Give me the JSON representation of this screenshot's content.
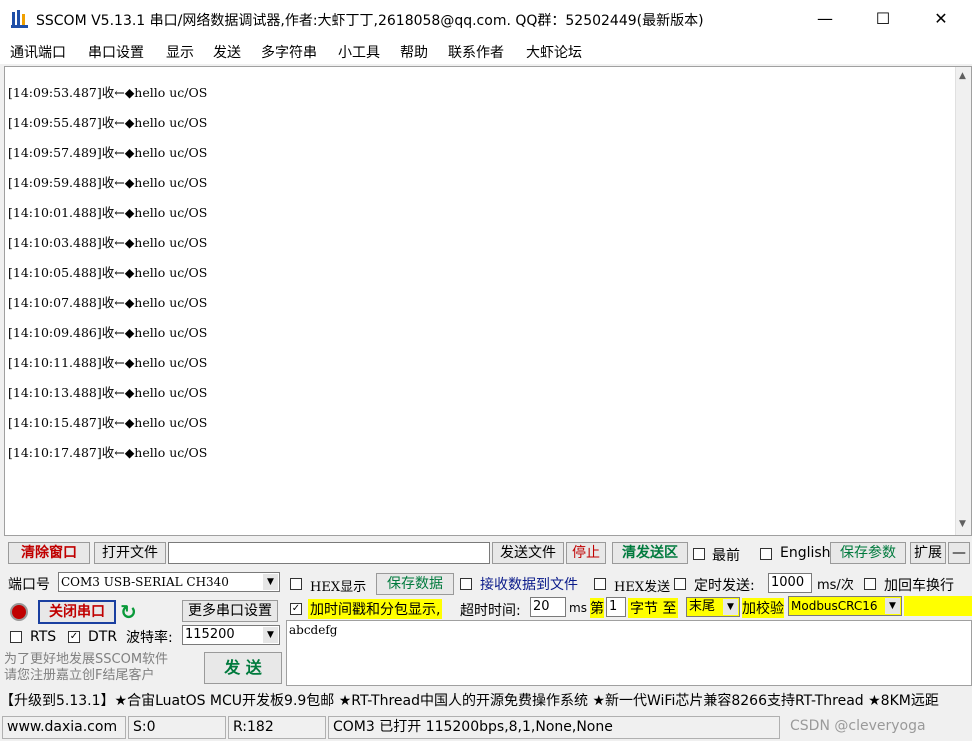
{
  "window": {
    "title": "SSCOM V5.13.1 串口/网络数据调试器,作者:大虾丁丁,2618058@qq.com. QQ群：52502449(最新版本)",
    "minimize": "—",
    "maximize": "☐",
    "close": "✕"
  },
  "menu": [
    "通讯端口",
    "串口设置",
    "显示",
    "发送",
    "多字符串",
    "小工具",
    "帮助",
    "联系作者",
    "大虾论坛"
  ],
  "log": [
    "[14:09:53.487]收←◆hello uc/OS",
    "[14:09:55.487]收←◆hello uc/OS",
    "[14:09:57.489]收←◆hello uc/OS",
    "[14:09:59.488]收←◆hello uc/OS",
    "[14:10:01.488]收←◆hello uc/OS",
    "[14:10:03.488]收←◆hello uc/OS",
    "[14:10:05.488]收←◆hello uc/OS",
    "[14:10:07.488]收←◆hello uc/OS",
    "[14:10:09.486]收←◆hello uc/OS",
    "[14:10:11.488]收←◆hello uc/OS",
    "[14:10:13.488]收←◆hello uc/OS",
    "[14:10:15.487]收←◆hello uc/OS",
    "[14:10:17.487]收←◆hello uc/OS"
  ],
  "toolbar": {
    "clear": "清除窗口",
    "open_file": "打开文件",
    "send_file": "发送文件",
    "stop": "停止",
    "clear_send": "清发送区",
    "topmost": "最前",
    "english": "English",
    "save_params": "保存参数",
    "expand": "扩展",
    "collapse": "—"
  },
  "port": {
    "label": "端口号",
    "value": "COM3 USB-SERIAL CH340",
    "close_port": "关闭串口",
    "more_settings": "更多串口设置",
    "rts": "RTS",
    "dtr": "DTR",
    "baud_label": "波特率:",
    "baud_value": "115200",
    "promo": "为了更好地发展SSCOM软件\n请您注册嘉立创F结尾客户",
    "send": "发  送"
  },
  "options": {
    "hex_display": "HEX显示",
    "save_data": "保存数据",
    "recv_to_file": "接收数据到文件",
    "hex_send": "HEX发送",
    "timed_send": "定时发送:",
    "interval": "1000",
    "interval_unit": "ms/次",
    "add_crlf": "加回车换行",
    "timestamp": "加时间戳和分包显示,",
    "timeout_label": "超时时间:",
    "timeout_value": "20",
    "timeout_unit": "ms",
    "byte_prefix": "第",
    "byte_index": "1",
    "byte_suffix": "字节 至",
    "byte_end": "末尾",
    "checksum_label": "加校验",
    "checksum_value": "ModbusCRC16"
  },
  "send_text": "abcdefg",
  "ticker": "【升级到5.13.1】★合宙LuatOS MCU开发板9.9包邮 ★RT-Thread中国人的开源免费操作系统 ★新一代WiFi芯片兼容8266支持RT-Thread ★8KM远距",
  "status": {
    "site": "www.daxia.com",
    "sent": "S:0",
    "recv": "R:182",
    "port_state": "COM3 已打开  115200bps,8,1,None,None",
    "watermark": "CSDN @cleveryoga"
  }
}
